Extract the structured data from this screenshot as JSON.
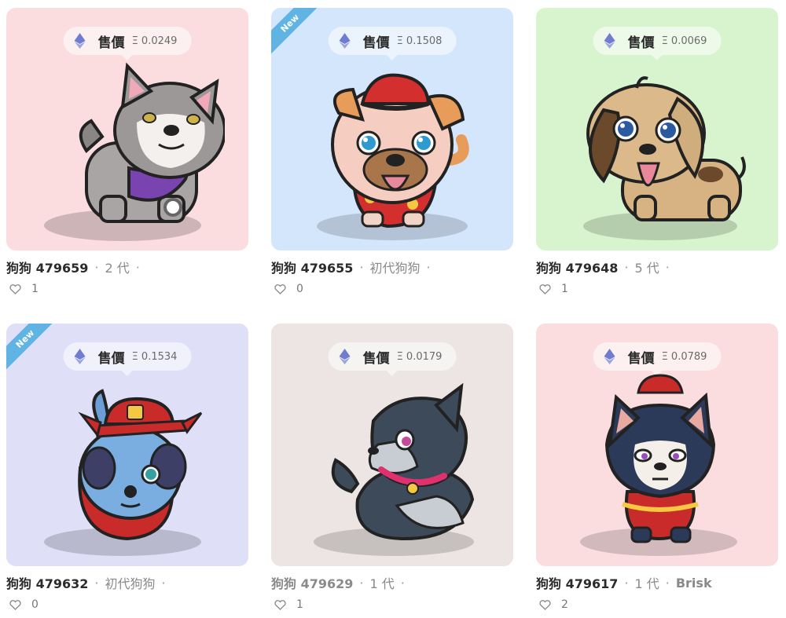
{
  "price_label": "售價",
  "eth_symbol": "Ξ",
  "new_badge": "New",
  "colors": {
    "eth_icon": "#6f7ccf",
    "ribbon": "#5fb4e3"
  },
  "kitties": [
    {
      "name": "狗狗 479659",
      "gen": "2 代",
      "cooldown": "",
      "price": "0.0249",
      "likes": "1",
      "is_new": false,
      "bg": "#fbdde0",
      "muted": false
    },
    {
      "name": "狗狗 479655",
      "gen": "初代狗狗",
      "cooldown": "",
      "price": "0.1508",
      "likes": "0",
      "is_new": true,
      "bg": "#d3e6fb",
      "muted": false
    },
    {
      "name": "狗狗 479648",
      "gen": "5 代",
      "cooldown": "",
      "price": "0.0069",
      "likes": "1",
      "is_new": false,
      "bg": "#d8f4cf",
      "muted": false
    },
    {
      "name": "狗狗 479632",
      "gen": "初代狗狗",
      "cooldown": "",
      "price": "0.1534",
      "likes": "0",
      "is_new": true,
      "bg": "#dfdff8",
      "muted": false
    },
    {
      "name": "狗狗 479629",
      "gen": "1 代",
      "cooldown": "",
      "price": "0.0179",
      "likes": "1",
      "is_new": false,
      "bg": "#ece5e4",
      "muted": true
    },
    {
      "name": "狗狗 479617",
      "gen": "1 代",
      "cooldown": "Brisk",
      "price": "0.0789",
      "likes": "2",
      "is_new": false,
      "bg": "#fbdde0",
      "muted": false
    }
  ]
}
